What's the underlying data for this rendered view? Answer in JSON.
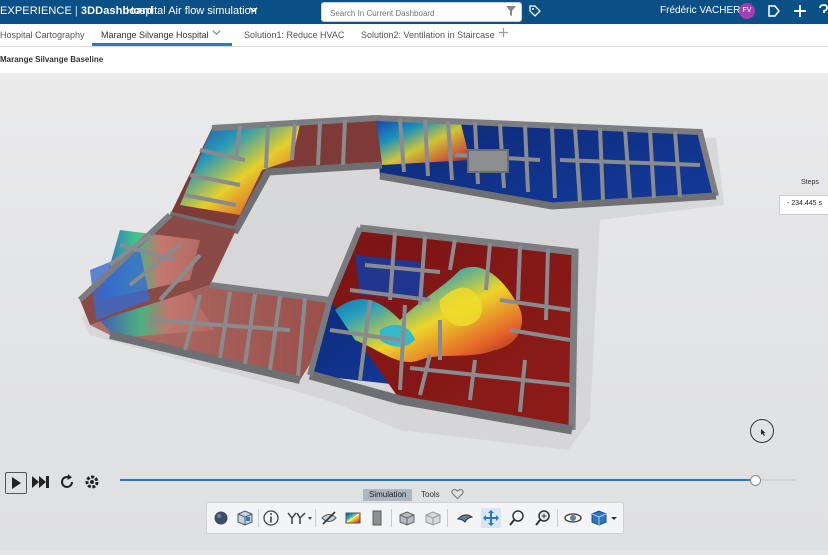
{
  "topbar": {
    "brand": "EXPERIENCE",
    "separator": "|",
    "dashboard": "3DDashboard",
    "title": "Hospital Air flow simulation",
    "search_placeholder": "Search In Current Dashboard",
    "user_name": "Frédéric VACHER",
    "user_initials": "FV"
  },
  "tabs": [
    {
      "label": "Hospital Cartography"
    },
    {
      "label": "Marange Silvange Hospital"
    },
    {
      "label": "Solution1: Reduce HVAC"
    },
    {
      "label": "Solution2: Ventilation in Staircase"
    }
  ],
  "subheader": {
    "title": "Marange Silvange Baseline"
  },
  "steps": {
    "label": "Steps",
    "value": "- 234.445 s"
  },
  "timeline": {
    "progress": 0.94
  },
  "section_tabs": {
    "simulation": "Simulation",
    "tools": "Tools"
  },
  "toolbar": {
    "tools": [
      "sphere-icon",
      "box-icon",
      "info-icon",
      "sensor-icon",
      "hide-icon",
      "contour-icon",
      "solid-icon",
      "assembly-icon",
      "assembly-ghost-icon",
      "fly-icon",
      "pan-icon",
      "zoom-region-icon",
      "zoom-icon",
      "rotate-icon",
      "cube-view-icon"
    ],
    "selected": "pan-icon"
  },
  "colors": {
    "brand_bar": "#0b4f87",
    "accent": "#2b78c1",
    "avatar": "#a33fb0"
  }
}
